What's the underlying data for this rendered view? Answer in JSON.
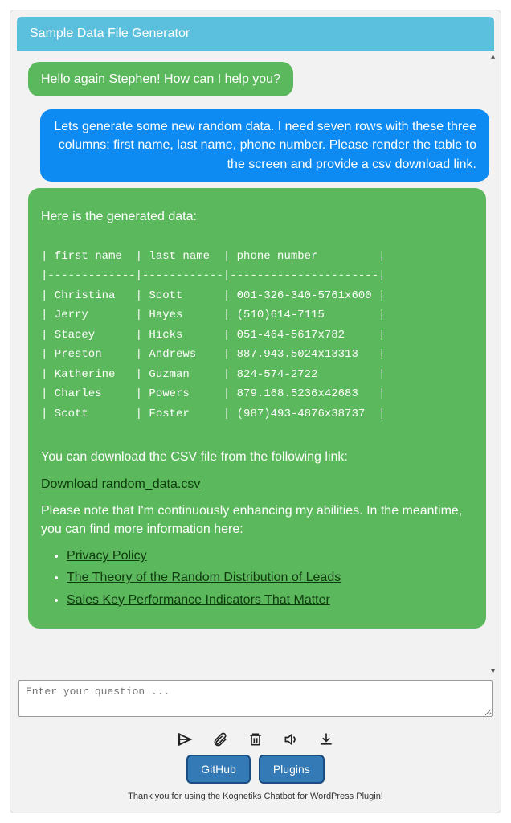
{
  "header": {
    "title": "Sample Data File Generator"
  },
  "messages": {
    "greeting": "Hello again Stephen! How can I help you?",
    "user_request": "Lets generate some new random data. I need seven rows with these three columns: first name, last name, phone number. Please render the table to the screen and provide a csv download link.",
    "bot": {
      "intro": "Here is the generated data:",
      "download_prompt": "You can download the CSV file from the following link:",
      "download_link_text": "Download random_data.csv",
      "note": "Please note that I'm continuously enhancing my abilities. In the meantime, you can find more information here:",
      "links": [
        "Privacy Policy",
        "The Theory of the Random Distribution of Leads",
        "Sales Key Performance Indicators That Matter"
      ]
    }
  },
  "chart_data": {
    "type": "table",
    "columns": [
      "first name",
      "last name",
      "phone number"
    ],
    "rows": [
      [
        "Christina",
        "Scott",
        "001-326-340-5761x600"
      ],
      [
        "Jerry",
        "Hayes",
        "(510)614-7115"
      ],
      [
        "Stacey",
        "Hicks",
        "051-464-5617x782"
      ],
      [
        "Preston",
        "Andrews",
        "887.943.5024x13313"
      ],
      [
        "Katherine",
        "Guzman",
        "824-574-2722"
      ],
      [
        "Charles",
        "Powers",
        "879.168.5236x42683"
      ],
      [
        "Scott",
        "Foster",
        "(987)493-4876x38737"
      ]
    ]
  },
  "input": {
    "placeholder": "Enter your question ..."
  },
  "buttons": {
    "github": "GitHub",
    "plugins": "Plugins"
  },
  "footer": {
    "text": "Thank you for using the Kognetiks Chatbot for WordPress Plugin!"
  }
}
